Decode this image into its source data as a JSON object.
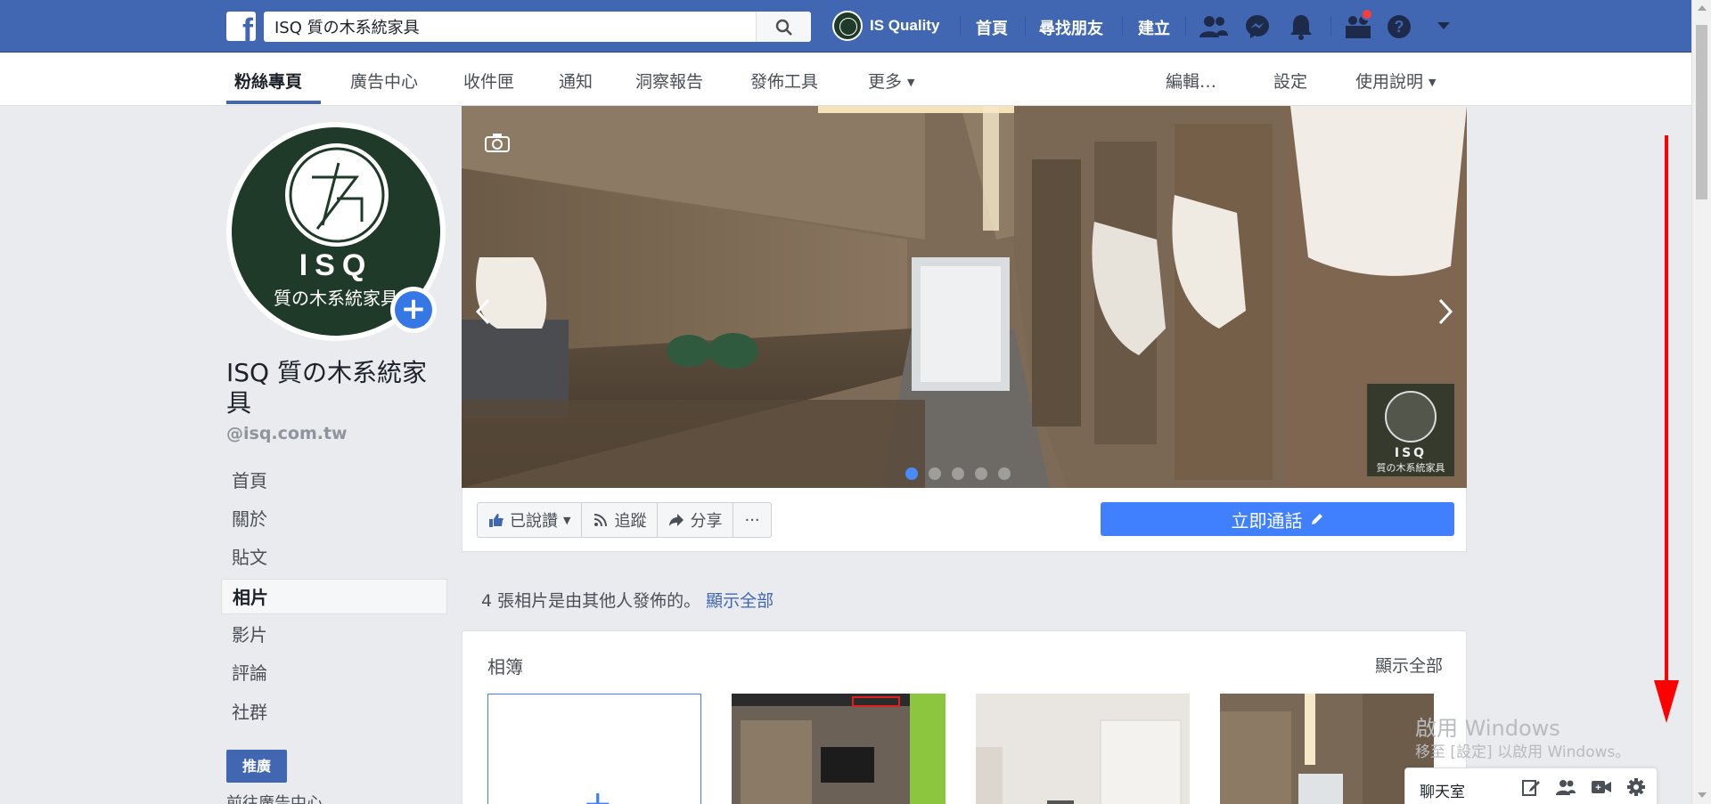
{
  "topbar": {
    "search_value": "ISQ 質の木系統家具",
    "profile_name": "IS Quality",
    "links": [
      "首頁",
      "尋找朋友",
      "建立"
    ]
  },
  "subnav": {
    "tabs": [
      "粉絲專頁",
      "廣告中心",
      "收件匣",
      "通知",
      "洞察報告",
      "發佈工具",
      "更多"
    ],
    "right": [
      "編輯…",
      "設定",
      "使用說明"
    ]
  },
  "profile": {
    "logo_text": "ISQ",
    "logo_sub": "質の木系統家具",
    "name": "ISQ 質の木系統家具",
    "handle": "@isq.com.tw"
  },
  "left_nav": [
    "首頁",
    "關於",
    "貼文",
    "相片",
    "影片",
    "評論",
    "社群"
  ],
  "promote_label": "推廣",
  "ad_center_label": "前往廣告中心",
  "cover": {
    "badge_text": "ISQ",
    "badge_sub": "質の木系統家具",
    "slide_count": 5,
    "active_slide": 1
  },
  "actions": {
    "liked": "已說讚",
    "follow": "追蹤",
    "share": "分享",
    "more": "···",
    "call": "立即通話"
  },
  "shared_photos": {
    "text": "4 張相片是由其他人發佈的。",
    "link": "顯示全部"
  },
  "albums": {
    "title": "相簿",
    "see_all": "顯示全部"
  },
  "watermark": {
    "line1": "啟用 Windows",
    "line2": "移至 [設定] 以啟用 Windows。"
  },
  "chat": {
    "label": "聊天室"
  },
  "colors": {
    "fb_blue": "#4267b2",
    "call_blue": "#4080ff",
    "annotation_red": "#ff0000"
  }
}
